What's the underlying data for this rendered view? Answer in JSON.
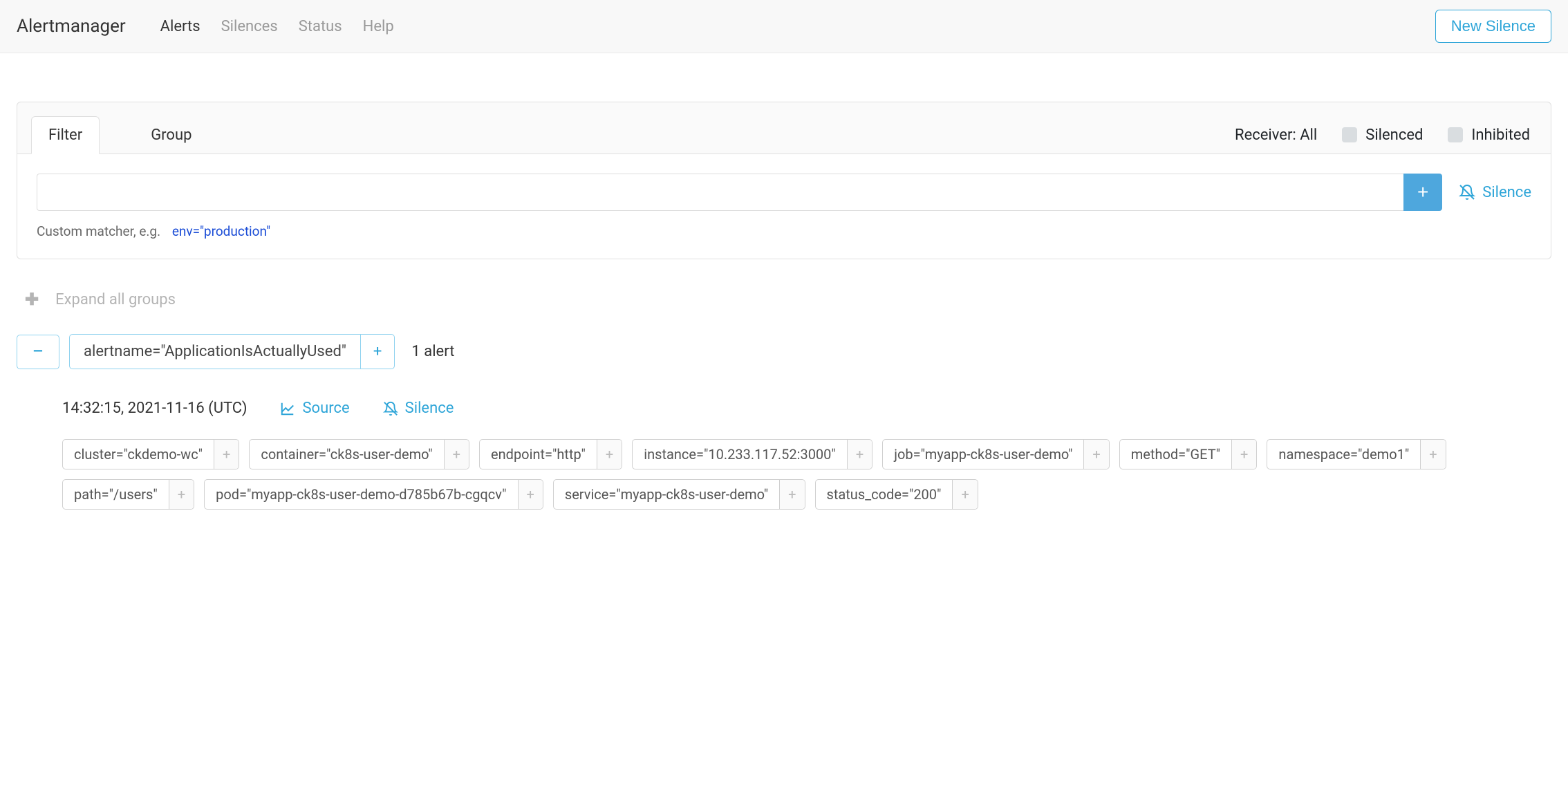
{
  "navbar": {
    "brand": "Alertmanager",
    "links": [
      {
        "label": "Alerts",
        "active": true
      },
      {
        "label": "Silences",
        "active": false
      },
      {
        "label": "Status",
        "active": false
      },
      {
        "label": "Help",
        "active": false
      }
    ],
    "new_silence": "New Silence"
  },
  "filter": {
    "tabs": [
      {
        "label": "Filter",
        "active": true
      },
      {
        "label": "Group",
        "active": false
      }
    ],
    "receiver_text": "Receiver: All",
    "silenced_label": "Silenced",
    "inhibited_label": "Inhibited",
    "input_value": "",
    "add_label": "+",
    "silence_label": "Silence",
    "hint_prefix": "Custom matcher, e.g.",
    "hint_code": "env=\"production\""
  },
  "expand_all": {
    "label": "Expand all groups"
  },
  "group": {
    "collapse_icon": "−",
    "label": "alertname=\"ApplicationIsActuallyUsed\"",
    "add": "+",
    "count": "1 alert"
  },
  "alert": {
    "timestamp": "14:32:15, 2021-11-16 (UTC)",
    "source": "Source",
    "silence": "Silence",
    "labels": [
      "cluster=\"ckdemo-wc\"",
      "container=\"ck8s-user-demo\"",
      "endpoint=\"http\"",
      "instance=\"10.233.117.52:3000\"",
      "job=\"myapp-ck8s-user-demo\"",
      "method=\"GET\"",
      "namespace=\"demo1\"",
      "path=\"/users\"",
      "pod=\"myapp-ck8s-user-demo-d785b67b-cgqcv\"",
      "service=\"myapp-ck8s-user-demo\"",
      "status_code=\"200\""
    ],
    "label_add": "+"
  }
}
